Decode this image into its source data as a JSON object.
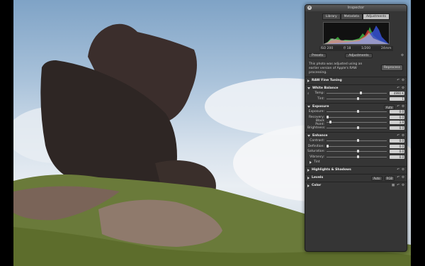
{
  "inspector": {
    "title": "Inspector",
    "tabs": [
      "Library",
      "Metadata",
      "Adjustments"
    ],
    "active_tab": "Adjustments",
    "exif": [
      "ISO 200",
      "f/ 18",
      "1/200",
      "24mm"
    ],
    "presets_label": "Presets",
    "adjustments_label": "Adjustments",
    "notice": "This photo was adjusted using an earlier version of Apple's RAW processing.",
    "reprocess_label": "Reprocess",
    "raw_fine_tuning": "RAW Fine Tuning",
    "white_balance": {
      "title": "White Balance",
      "params": [
        {
          "label": "Temp:",
          "value": "4990 K",
          "pos": 0.55
        },
        {
          "label": "Tint:",
          "value": "1",
          "pos": 0.5
        }
      ]
    },
    "exposure": {
      "title": "Exposure",
      "auto_label": "Auto",
      "params": [
        {
          "label": "Exposure:",
          "value": "0.0",
          "pos": 0.5
        },
        {
          "label": "Recovery:",
          "value": "0.0",
          "pos": 0.0
        },
        {
          "label": "Black Point:",
          "value": "3.9",
          "pos": 0.05
        },
        {
          "label": "Brightness:",
          "value": "0.0",
          "pos": 0.5
        }
      ]
    },
    "enhance": {
      "title": "Enhance",
      "params": [
        {
          "label": "Contrast:",
          "value": "0.0",
          "pos": 0.5
        },
        {
          "label": "Definition:",
          "value": "0.0",
          "pos": 0.0
        },
        {
          "label": "Saturation:",
          "value": "0.0",
          "pos": 0.5
        },
        {
          "label": "Vibrancy:",
          "value": "0.0",
          "pos": 0.5
        }
      ],
      "tint_label": "Tint"
    },
    "highlights_shadows": "Highlights & Shadows",
    "levels": {
      "title": "Levels",
      "auto_label": "Auto",
      "option_label": "RGB"
    },
    "color": "Color"
  }
}
